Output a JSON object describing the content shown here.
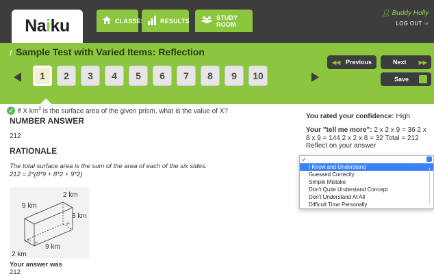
{
  "app": {
    "logo": "Naiku",
    "user_name": "Buddy Holly",
    "logout_label": "LOG OUT"
  },
  "nav": {
    "classes": "CLASSES",
    "results": "RESULTS",
    "study_room": "STUDY ROOM"
  },
  "test": {
    "title": "Sample Test with Varied Items: Reflection",
    "info_icon": "i",
    "question_numbers": [
      "1",
      "2",
      "3",
      "4",
      "5",
      "6",
      "7",
      "8",
      "9",
      "10"
    ],
    "active_question": "1"
  },
  "controls": {
    "previous_label": "Previous",
    "next_label": "Next",
    "save_label": "Save"
  },
  "question": {
    "text_before": "If X km",
    "superscript": "2",
    "text_after": " is the surface area of the given prism, what is the value of X?"
  },
  "number_answer": {
    "heading": "NUMBER ANSWER",
    "value": "212"
  },
  "rationale": {
    "heading": "RATIONALE",
    "text": "The total surface area is the sum of the area of each of the six sides. 212 = 2*(8*9 + 8*2 + 9*2)"
  },
  "figure": {
    "label_top": "2 km",
    "label_left": "9 km",
    "label_right": "8 km",
    "label_bottom": "9 km",
    "label_corner": "2 km"
  },
  "your_answer": {
    "label": "Your answer was",
    "value": "212"
  },
  "reflection": {
    "confidence_label": "You rated your confidence:",
    "confidence_value": "High",
    "tellme_label": "Your \"tell me more\":",
    "tellme_value": "2 x 2 x 9 = 36 2 x 8 x 9 = 144 2 x 2 x 8 = 32 Total = 212",
    "reflect_label": "Reflect on your answer",
    "options": [
      "✓",
      "I Know and Understand",
      "Guessed Correctly",
      "Simple Mistake",
      "Don't Quite Understand Concept",
      "Don't Understand At All",
      "Difficult Time Personally"
    ],
    "highlighted_index": 1
  }
}
